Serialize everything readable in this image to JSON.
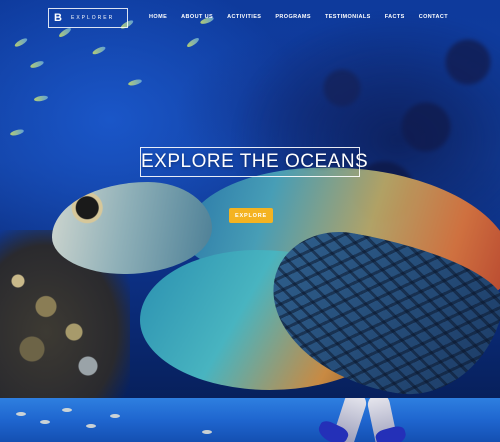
{
  "brand": {
    "mark": "B",
    "name": "EXPLORER"
  },
  "nav": {
    "links": [
      "HOME",
      "ABOUT US",
      "ACTIVITIES",
      "PROGRAMS",
      "TESTIMONIALS",
      "FACTS",
      "CONTACT"
    ]
  },
  "hero": {
    "headline": "EXPLORE THE OCEANS",
    "cta_label": "EXPLORE",
    "cta_color": "#f4b321"
  },
  "colors": {
    "ocean": "#123f9f",
    "strip": "#1f66cf"
  }
}
